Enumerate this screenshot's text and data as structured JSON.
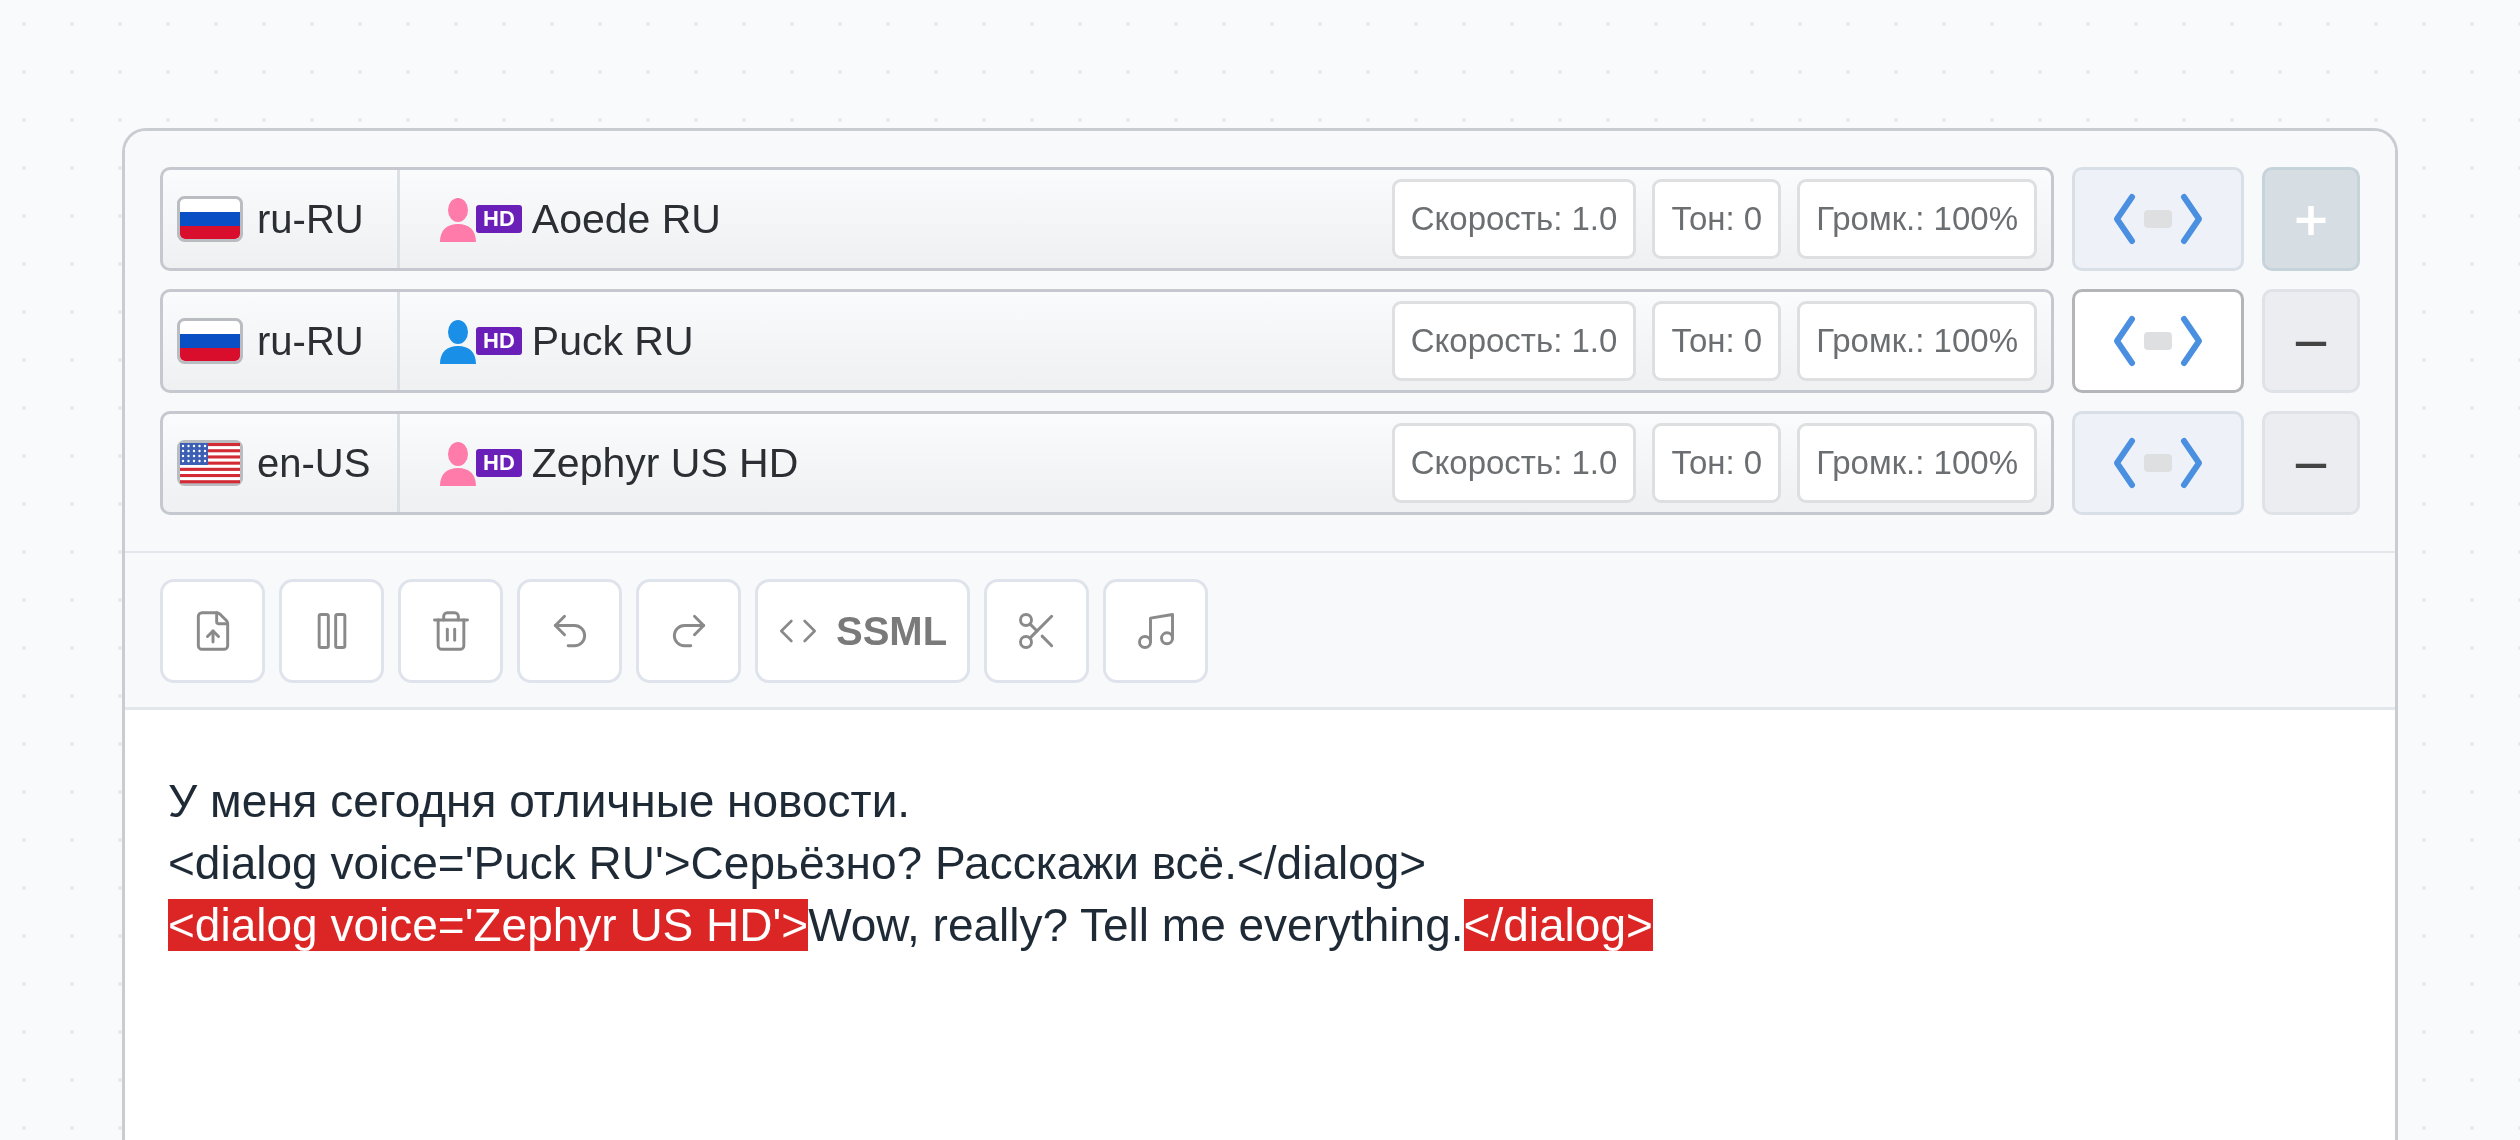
{
  "voices": [
    {
      "kind": "ru",
      "lang": "ru-RU",
      "color": "#ff7ba9",
      "badge": "HD",
      "name": "Aoede RU",
      "params": [
        "Скорость: 1.0",
        "Тон: 0",
        "Громк.: 100%"
      ],
      "code_selected": false,
      "action": {
        "kind": "add",
        "symbol": "+"
      }
    },
    {
      "kind": "ru",
      "lang": "ru-RU",
      "color": "#1a8fe8",
      "badge": "HD",
      "name": "Puck RU",
      "params": [
        "Скорость: 1.0",
        "Тон: 0",
        "Громк.: 100%"
      ],
      "code_selected": true,
      "action": {
        "kind": "remove",
        "symbol": "—"
      }
    },
    {
      "kind": "us",
      "lang": "en-US",
      "color": "#ff7ba9",
      "badge": "HD",
      "name": "Zephyr US HD",
      "params": [
        "Скорость: 1.0",
        "Тон: 0",
        "Громк.: 100%"
      ],
      "code_selected": false,
      "action": {
        "kind": "remove",
        "symbol": "—"
      }
    }
  ],
  "toolbar": {
    "ssml_label": "SSML"
  },
  "editor": {
    "lines": [
      {
        "segments": [
          {
            "text": "У меня сегодня отличные новости.",
            "highlighted": false
          }
        ]
      },
      {
        "segments": [
          {
            "text": "<dialog voice='Puck RU'>Серьёзно? Расскажи всё.</dialog>",
            "highlighted": false
          }
        ]
      },
      {
        "segments": [
          {
            "text": "<dialog voice='Zephyr US HD'>",
            "highlighted": true
          },
          {
            "text": "Wow, really? Tell me everything.",
            "highlighted": false
          },
          {
            "text": "</dialog>",
            "highlighted": true
          }
        ]
      }
    ]
  }
}
